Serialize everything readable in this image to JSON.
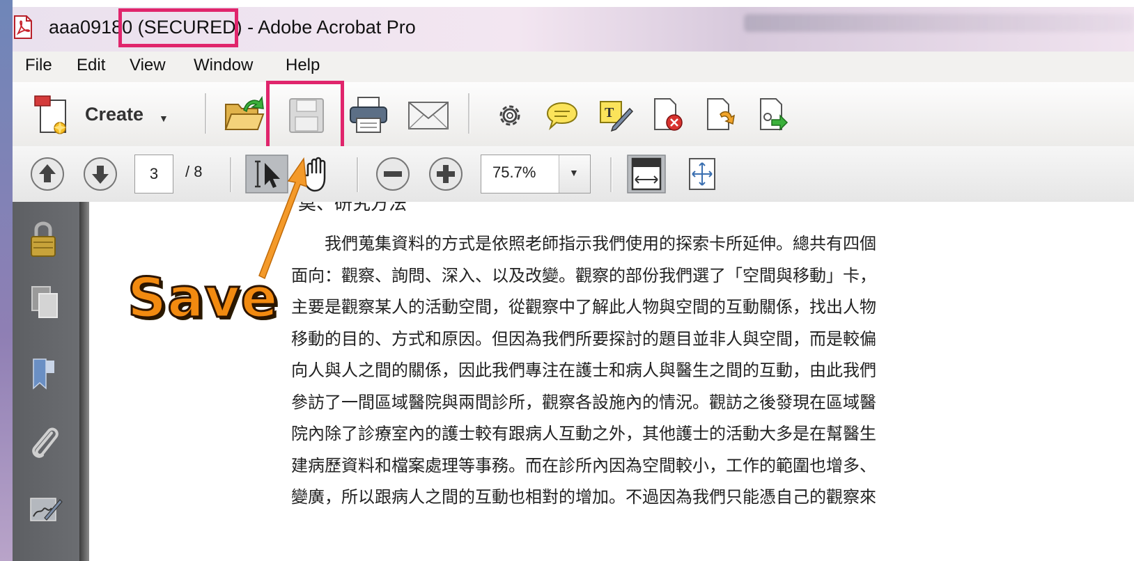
{
  "window": {
    "title": "aaa09180 (SECURED) - Adobe Acrobat Pro"
  },
  "menu": [
    "File",
    "Edit",
    "View",
    "Window",
    "Help"
  ],
  "toolbar": {
    "create_label": "Create"
  },
  "navigation": {
    "current_page": "3",
    "total_pages": "/ 8",
    "zoom": "75.7%"
  },
  "annotation": {
    "callout": "Save"
  },
  "document": {
    "heading_fragment": "莫、研究方法",
    "paragraph_lines": [
      "我們蒐集資料的方式是依照老師指示我們使用的探索卡所延伸。總共有四個",
      "面向：觀察、詢問、深入、以及改變。觀察的部份我們選了「空間與移動」卡，",
      "主要是觀察某人的活動空間，從觀察中了解此人物與空間的互動關係，找出人物",
      "移動的目的、方式和原因。但因為我們所要探討的題目並非人與空間，而是較偏",
      "向人與人之間的關係，因此我們專注在護士和病人與醫生之間的互動，由此我們",
      "參訪了一間區域醫院與兩間診所，觀察各設施內的情況。觀訪之後發現在區域醫",
      "院內除了診療室內的護士較有跟病人互動之外，其他護士的活動大多是在幫醫生",
      "建病歷資料和檔案處理等事務。而在診所內因為空間較小，工作的範圍也增多、",
      "變廣，所以跟病人之間的互動也相對的增加。不過因為我們只能憑自己的觀察來"
    ]
  },
  "colors": {
    "highlight_box": "#e0256c",
    "callout_fill": "#f28a10",
    "sidebar_bg": "#646669"
  }
}
